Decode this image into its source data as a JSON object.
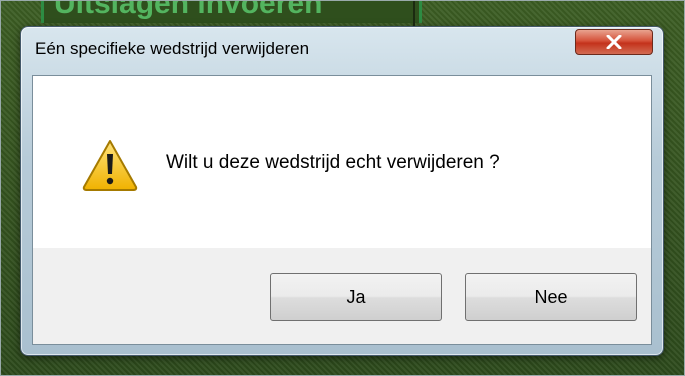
{
  "background": {
    "header_text": "Uitslagen invoeren"
  },
  "dialog": {
    "title": "Eén specifieke wedstrijd verwijderen",
    "message": "Wilt u deze wedstrijd echt verwijderen ?",
    "icon": "warning-icon",
    "buttons": {
      "yes": "Ja",
      "no": "Nee"
    },
    "close_icon": "close-icon"
  },
  "colors": {
    "close_button": "#c4321b",
    "warning_yellow": "#f4c21a"
  }
}
